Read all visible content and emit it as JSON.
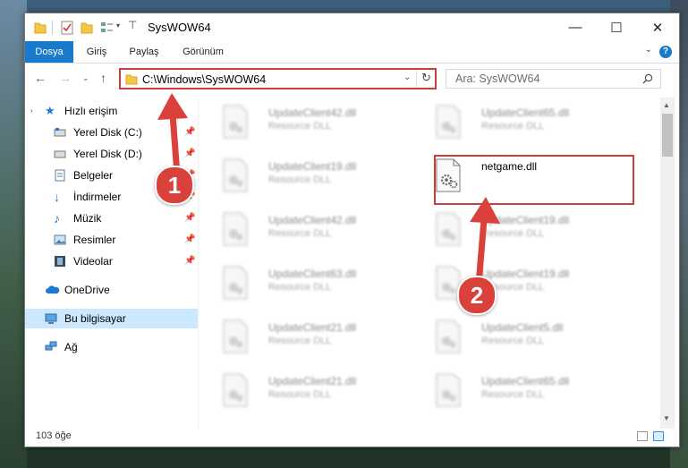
{
  "window": {
    "title": "SysWOW64"
  },
  "ribbon": {
    "tabs": [
      {
        "label": "Dosya"
      },
      {
        "label": "Giriş"
      },
      {
        "label": "Paylaş"
      },
      {
        "label": "Görünüm"
      }
    ],
    "help_label": "?"
  },
  "navigation": {
    "address": "C:\\Windows\\SysWOW64",
    "search_placeholder": "Ara: SysWOW64"
  },
  "sidebar": {
    "items": [
      {
        "label": "Hızlı erişim",
        "icon": "star-icon"
      },
      {
        "label": "Yerel Disk (C:)",
        "icon": "drive-icon",
        "pinned": true
      },
      {
        "label": "Yerel Disk (D:)",
        "icon": "drive-icon",
        "pinned": true
      },
      {
        "label": "Belgeler",
        "icon": "documents-icon",
        "pinned": true
      },
      {
        "label": "İndirmeler",
        "icon": "download-icon",
        "pinned": true
      },
      {
        "label": "Müzik",
        "icon": "music-icon",
        "pinned": true
      },
      {
        "label": "Resimler",
        "icon": "pictures-icon",
        "pinned": true
      },
      {
        "label": "Videolar",
        "icon": "videos-icon",
        "pinned": true
      },
      {
        "label": "OneDrive",
        "icon": "cloud-icon"
      },
      {
        "label": "Bu bilgisayar",
        "icon": "computer-icon",
        "selected": true
      },
      {
        "label": "Ağ",
        "icon": "network-icon"
      }
    ]
  },
  "files": [
    {
      "name": "UpdateClient42.dll",
      "desc": "Resource DLL"
    },
    {
      "name": "UpdateClient65.dll",
      "desc": "Resource DLL"
    },
    {
      "name": "UpdateClient19.dll",
      "desc": "Resource DLL"
    },
    {
      "name": "netgame.dll",
      "desc": ""
    },
    {
      "name": "UpdateClient42.dll",
      "desc": "Resource DLL"
    },
    {
      "name": "UpdateClient19.dll",
      "desc": "Resource DLL"
    },
    {
      "name": "UpdateClient63.dll",
      "desc": "Resource DLL"
    },
    {
      "name": "UpdateClient19.dll",
      "desc": "Resource DLL"
    },
    {
      "name": "UpdateClient21.dll",
      "desc": "Resource DLL"
    },
    {
      "name": "UpdateClient5.dll",
      "desc": "Resource DLL"
    },
    {
      "name": "UpdateClient21.dll",
      "desc": "Resource DLL"
    },
    {
      "name": "UpdateClient65.dll",
      "desc": "Resource DLL"
    }
  ],
  "status": {
    "count": "103 öğe"
  },
  "annotations": {
    "badge1": "1",
    "badge2": "2",
    "color": "#d9413a"
  }
}
